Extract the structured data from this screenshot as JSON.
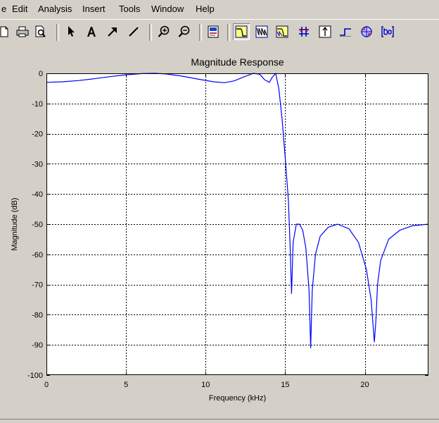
{
  "menu": [
    "e",
    "Edit",
    "Analysis",
    "Insert",
    "Tools",
    "Window",
    "Help"
  ],
  "toolbar": {
    "buttons": [
      {
        "name": "new-file-icon"
      },
      {
        "name": "print-icon"
      },
      {
        "name": "print-preview-icon"
      },
      {
        "name": "select-arrow-icon"
      },
      {
        "name": "insert-text-icon"
      },
      {
        "name": "insert-arrow-icon"
      },
      {
        "name": "insert-line-icon"
      },
      {
        "name": "zoom-in-icon"
      },
      {
        "name": "zoom-out-icon"
      },
      {
        "name": "filter-spec-icon"
      },
      {
        "name": "magnitude-response-icon",
        "active": true
      },
      {
        "name": "phase-response-icon"
      },
      {
        "name": "magnitude-phase-icon"
      },
      {
        "name": "group-delay-icon"
      },
      {
        "name": "impulse-response-icon"
      },
      {
        "name": "step-response-icon"
      },
      {
        "name": "pole-zero-icon"
      },
      {
        "name": "filter-coefficients-icon"
      }
    ]
  },
  "chart_data": {
    "type": "line",
    "title": "Magnitude Response",
    "xlabel": "Frequency (kHz)",
    "ylabel": "Magnitude (dB)",
    "xlim": [
      0,
      24
    ],
    "ylim": [
      -100,
      0
    ],
    "xticks": [
      0,
      5,
      10,
      15,
      20
    ],
    "yticks": [
      0,
      -10,
      -20,
      -30,
      -40,
      -50,
      -60,
      -70,
      -80,
      -90,
      -100
    ],
    "grid": true,
    "line_color": "#0000ff",
    "series": [
      {
        "x": [
          0,
          1,
          2,
          3,
          4,
          5,
          6,
          6.8,
          7.5,
          8.5,
          9.5,
          10.5,
          11.2,
          11.8,
          12.4,
          13,
          13.4,
          13.7,
          14,
          14.2,
          14.4,
          14.6,
          14.8,
          15,
          15.2,
          15.3,
          15.4,
          15.5,
          15.7,
          15.9,
          16.1,
          16.3,
          16.5,
          16.6,
          16.7,
          16.9,
          17.2,
          17.7,
          18.3,
          19,
          19.6,
          20.1,
          20.4,
          20.6,
          20.7,
          20.8,
          21,
          21.5,
          22.2,
          23,
          24
        ],
        "y": [
          -3,
          -2.8,
          -2.4,
          -1.8,
          -1.1,
          -0.5,
          -0.1,
          0,
          -0.2,
          -0.9,
          -1.9,
          -2.8,
          -3.1,
          -2.5,
          -1.2,
          0,
          -0.3,
          -2.1,
          -3,
          -1.2,
          0,
          -5,
          -15,
          -28,
          -42,
          -56,
          -73,
          -56,
          -50,
          -50,
          -52,
          -58,
          -72,
          -91,
          -72,
          -60,
          -54,
          -51,
          -50,
          -51.5,
          -56,
          -65,
          -75,
          -89,
          -82,
          -70,
          -62,
          -55,
          -52,
          -50.5,
          -50
        ]
      }
    ]
  }
}
